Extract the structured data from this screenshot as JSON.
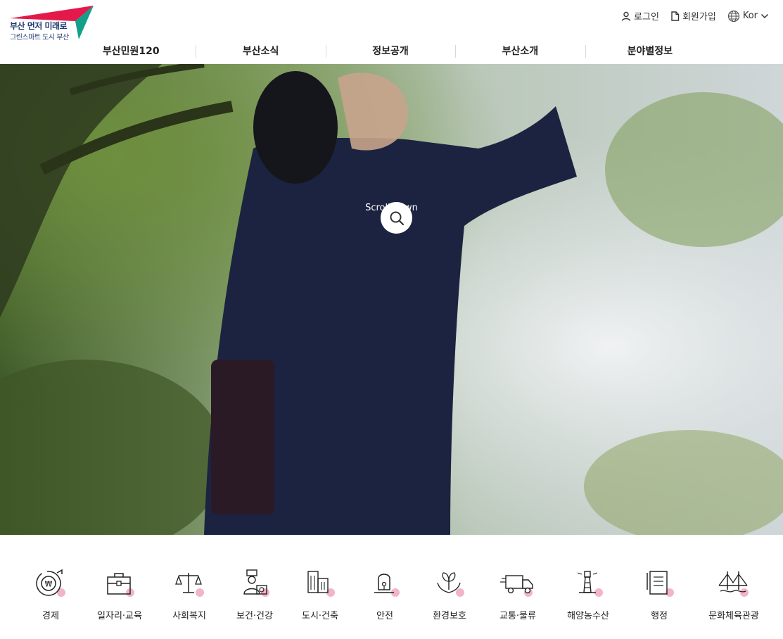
{
  "header": {
    "logo": {
      "line1": "부산 먼저 미래로",
      "line2": "그린스마트 도시 부산"
    },
    "util": {
      "login": "로그인",
      "signup": "회원가입",
      "language": "Kor"
    },
    "nav": [
      {
        "label": "부산민원120"
      },
      {
        "label": "부산소식"
      },
      {
        "label": "정보공개"
      },
      {
        "label": "부산소개"
      },
      {
        "label": "분야별정보"
      }
    ]
  },
  "hero": {
    "scroll_text": "Scroll down"
  },
  "categories": [
    {
      "label": "경제",
      "icon": "economy-icon"
    },
    {
      "label": "일자리·교육",
      "icon": "briefcase-icon"
    },
    {
      "label": "사회복지",
      "icon": "scales-icon"
    },
    {
      "label": "보건·건강",
      "icon": "doctor-icon"
    },
    {
      "label": "도시·건축",
      "icon": "buildings-icon"
    },
    {
      "label": "안전",
      "icon": "siren-icon"
    },
    {
      "label": "환경보호",
      "icon": "plant-hands-icon"
    },
    {
      "label": "교통·물류",
      "icon": "truck-icon"
    },
    {
      "label": "해양농수산",
      "icon": "lighthouse-icon"
    },
    {
      "label": "행정",
      "icon": "document-icon"
    },
    {
      "label": "문화체육관광",
      "icon": "bridge-icon"
    }
  ],
  "colors": {
    "logo_red": "#e4194b",
    "logo_green": "#12a08a",
    "logo_navy": "#1d3b73",
    "icon_accent": "#f1b6c6"
  }
}
